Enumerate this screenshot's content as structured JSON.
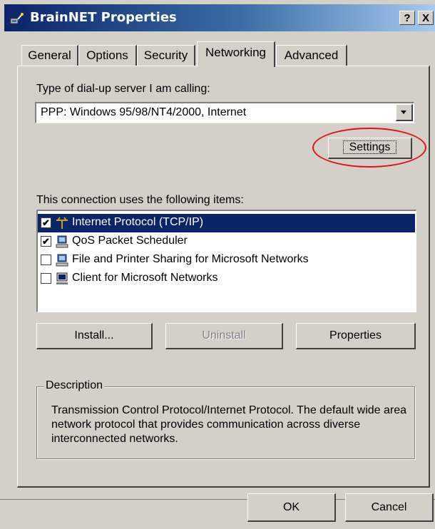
{
  "window": {
    "title": "BrainNET Properties",
    "help_label": "?",
    "close_label": "X",
    "colors": {
      "title_gradient_start": "#0a246a",
      "title_gradient_end": "#a6caf0",
      "selection": "#0a246a",
      "annotation_circle": "#e0101a"
    }
  },
  "tabs": [
    {
      "label": "General",
      "active": false
    },
    {
      "label": "Options",
      "active": false
    },
    {
      "label": "Security",
      "active": false
    },
    {
      "label": "Networking",
      "active": true
    },
    {
      "label": "Advanced",
      "active": false
    }
  ],
  "server_type": {
    "label": "Type of dial-up server I am calling:",
    "selected": "PPP: Windows 95/98/NT4/2000, Internet"
  },
  "settings_button": {
    "label": "Settings"
  },
  "components": {
    "label": "This connection uses the following items:",
    "items": [
      {
        "label": "Internet Protocol (TCP/IP)",
        "checked": true,
        "selected": true,
        "icon": "protocol-icon"
      },
      {
        "label": "QoS Packet Scheduler",
        "checked": true,
        "selected": false,
        "icon": "network-service-icon"
      },
      {
        "label": "File and Printer Sharing for Microsoft Networks",
        "checked": false,
        "selected": false,
        "icon": "network-service-icon"
      },
      {
        "label": "Client for Microsoft Networks",
        "checked": false,
        "selected": false,
        "icon": "network-client-icon"
      }
    ]
  },
  "actions": {
    "install": "Install...",
    "uninstall": "Uninstall",
    "properties": "Properties"
  },
  "description": {
    "legend": "Description",
    "text": "Transmission Control Protocol/Internet Protocol. The default wide area network protocol that provides communication across diverse interconnected networks."
  },
  "dialog_buttons": {
    "ok": "OK",
    "cancel": "Cancel"
  },
  "checkmark_glyph": "✔"
}
